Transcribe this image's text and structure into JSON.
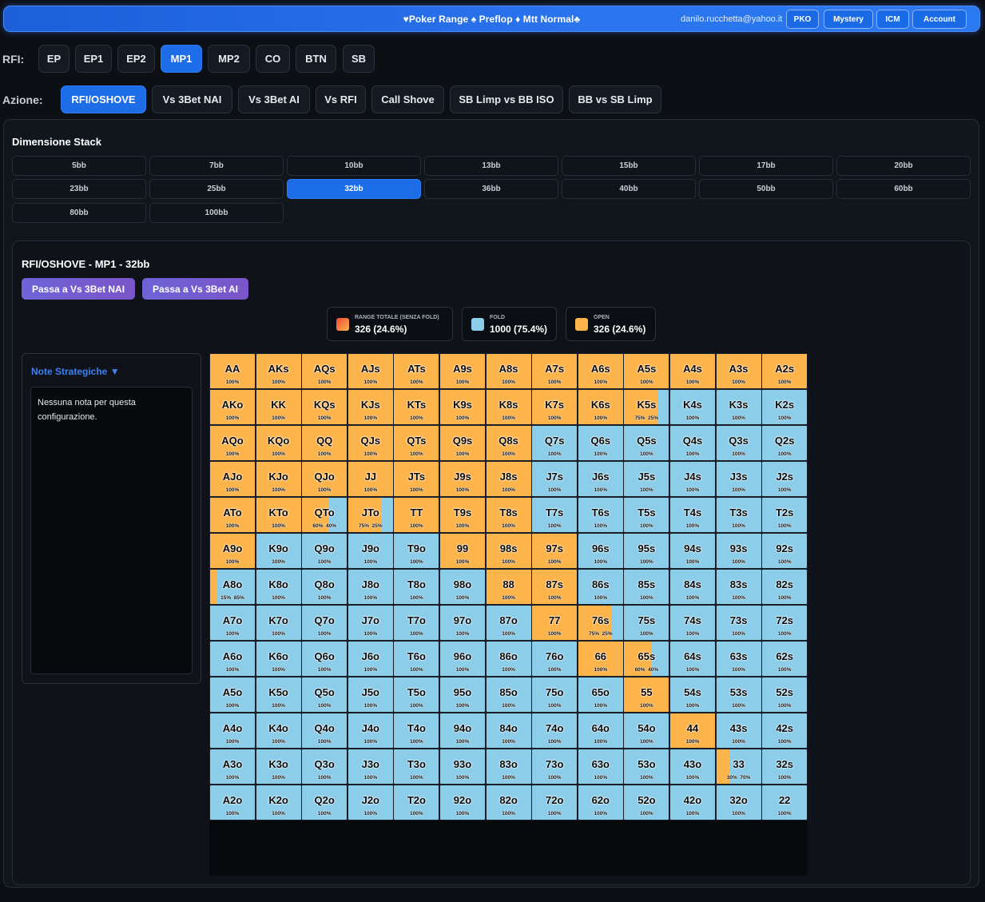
{
  "header": {
    "title": "♥Poker Range ♠ Preflop ♦ Mtt Normal♣",
    "email": "danilo.rucchetta@yahoo.it",
    "buttons": [
      "PKO",
      "Mystery",
      "ICM",
      "Account"
    ]
  },
  "rfi": {
    "label": "RFI:",
    "positions": [
      "EP",
      "EP1",
      "EP2",
      "MP1",
      "MP2",
      "CO",
      "BTN",
      "SB"
    ],
    "active": "MP1"
  },
  "azione": {
    "label": "Azione:",
    "actions": [
      "RFI/OSHOVE",
      "Vs 3Bet NAI",
      "Vs 3Bet AI",
      "Vs RFI",
      "Call Shove",
      "SB Limp vs BB ISO",
      "BB vs SB Limp"
    ],
    "active": "RFI/OSHOVE"
  },
  "stack": {
    "title": "Dimensione Stack",
    "sizes": [
      "5bb",
      "7bb",
      "10bb",
      "13bb",
      "15bb",
      "17bb",
      "20bb",
      "23bb",
      "25bb",
      "32bb",
      "36bb",
      "40bb",
      "50bb",
      "60bb",
      "80bb",
      "100bb"
    ],
    "active": "32bb"
  },
  "range": {
    "title": "RFI/OSHOVE - MP1 - 32bb",
    "buttons": [
      "Passa a Vs 3Bet NAI",
      "Passa a Vs 3Bet AI"
    ]
  },
  "stats": [
    {
      "label": "RANGE TOTALE (SENZA FOLD)",
      "value": "326 (24.6%)",
      "swatch": "gradient"
    },
    {
      "label": "FOLD",
      "value": "1000 (75.4%)",
      "swatch": "#8ccde9"
    },
    {
      "label": "OPEN",
      "value": "326 (24.6%)",
      "swatch": "#fdb44b"
    }
  ],
  "notes": {
    "title": "Note Strategiche ▼",
    "text": "Nessuna nota per questa configurazione."
  },
  "colors": {
    "open": "#fdb44b",
    "fold": "#8ccde9",
    "accent": "#1d6ce8"
  },
  "grid": {
    "hands": [
      [
        "AA",
        "AKs",
        "AQs",
        "AJs",
        "ATs",
        "A9s",
        "A8s",
        "A7s",
        "A6s",
        "A5s",
        "A4s",
        "A3s",
        "A2s"
      ],
      [
        "AKo",
        "KK",
        "KQs",
        "KJs",
        "KTs",
        "K9s",
        "K8s",
        "K7s",
        "K6s",
        "K5s",
        "K4s",
        "K3s",
        "K2s"
      ],
      [
        "AQo",
        "KQo",
        "QQ",
        "QJs",
        "QTs",
        "Q9s",
        "Q8s",
        "Q7s",
        "Q6s",
        "Q5s",
        "Q4s",
        "Q3s",
        "Q2s"
      ],
      [
        "AJo",
        "KJo",
        "QJo",
        "JJ",
        "JTs",
        "J9s",
        "J8s",
        "J7s",
        "J6s",
        "J5s",
        "J4s",
        "J3s",
        "J2s"
      ],
      [
        "ATo",
        "KTo",
        "QTo",
        "JTo",
        "TT",
        "T9s",
        "T8s",
        "T7s",
        "T6s",
        "T5s",
        "T4s",
        "T3s",
        "T2s"
      ],
      [
        "A9o",
        "K9o",
        "Q9o",
        "J9o",
        "T9o",
        "99",
        "98s",
        "97s",
        "96s",
        "95s",
        "94s",
        "93s",
        "92s"
      ],
      [
        "A8o",
        "K8o",
        "Q8o",
        "J8o",
        "T8o",
        "98o",
        "88",
        "87s",
        "86s",
        "85s",
        "84s",
        "83s",
        "82s"
      ],
      [
        "A7o",
        "K7o",
        "Q7o",
        "J7o",
        "T7o",
        "97o",
        "87o",
        "77",
        "76s",
        "75s",
        "74s",
        "73s",
        "72s"
      ],
      [
        "A6o",
        "K6o",
        "Q6o",
        "J6o",
        "T6o",
        "96o",
        "86o",
        "76o",
        "66",
        "65s",
        "64s",
        "63s",
        "62s"
      ],
      [
        "A5o",
        "K5o",
        "Q5o",
        "J5o",
        "T5o",
        "95o",
        "85o",
        "75o",
        "65o",
        "55",
        "54s",
        "53s",
        "52s"
      ],
      [
        "A4o",
        "K4o",
        "Q4o",
        "J4o",
        "T4o",
        "94o",
        "84o",
        "74o",
        "64o",
        "54o",
        "44",
        "43s",
        "42s"
      ],
      [
        "A3o",
        "K3o",
        "Q3o",
        "J3o",
        "T3o",
        "93o",
        "83o",
        "73o",
        "63o",
        "53o",
        "43o",
        "33",
        "32s"
      ],
      [
        "A2o",
        "K2o",
        "Q2o",
        "J2o",
        "T2o",
        "92o",
        "82o",
        "72o",
        "62o",
        "52o",
        "42o",
        "32o",
        "22"
      ]
    ],
    "open_fraction": [
      [
        1,
        1,
        1,
        1,
        1,
        1,
        1,
        1,
        1,
        1,
        1,
        1,
        1
      ],
      [
        1,
        1,
        1,
        1,
        1,
        1,
        1,
        1,
        1,
        0.75,
        0,
        0,
        0
      ],
      [
        1,
        1,
        1,
        1,
        1,
        1,
        1,
        0,
        0,
        0,
        0,
        0,
        0
      ],
      [
        1,
        1,
        1,
        1,
        1,
        1,
        1,
        0,
        0,
        0,
        0,
        0,
        0
      ],
      [
        1,
        1,
        0.6,
        0.75,
        1,
        1,
        1,
        0,
        0,
        0,
        0,
        0,
        0
      ],
      [
        1,
        0,
        0,
        0,
        0,
        1,
        1,
        1,
        0,
        0,
        0,
        0,
        0
      ],
      [
        0.15,
        0,
        0,
        0,
        0,
        0,
        1,
        1,
        0,
        0,
        0,
        0,
        0
      ],
      [
        0,
        0,
        0,
        0,
        0,
        0,
        0,
        1,
        0.75,
        0,
        0,
        0,
        0
      ],
      [
        0,
        0,
        0,
        0,
        0,
        0,
        0,
        0,
        1,
        0.6,
        0,
        0,
        0
      ],
      [
        0,
        0,
        0,
        0,
        0,
        0,
        0,
        0,
        0,
        1,
        0,
        0,
        0
      ],
      [
        0,
        0,
        0,
        0,
        0,
        0,
        0,
        0,
        0,
        0,
        1,
        0,
        0
      ],
      [
        0,
        0,
        0,
        0,
        0,
        0,
        0,
        0,
        0,
        0,
        0,
        0.3,
        0
      ],
      [
        0,
        0,
        0,
        0,
        0,
        0,
        0,
        0,
        0,
        0,
        0,
        0,
        0
      ]
    ],
    "labels": [
      [
        "100%",
        "100%",
        "100%",
        "100%",
        "100%",
        "100%",
        "100%",
        "100%",
        "100%",
        "100%",
        "100%",
        "100%",
        "100%"
      ],
      [
        "100%",
        "100%",
        "100%",
        "100%",
        "100%",
        "100%",
        "100%",
        "100%",
        "100%",
        "75%  25%",
        "100%",
        "100%",
        "100%"
      ],
      [
        "100%",
        "100%",
        "100%",
        "100%",
        "100%",
        "100%",
        "100%",
        "100%",
        "100%",
        "100%",
        "100%",
        "100%",
        "100%"
      ],
      [
        "100%",
        "100%",
        "100%",
        "100%",
        "100%",
        "100%",
        "100%",
        "100%",
        "100%",
        "100%",
        "100%",
        "100%",
        "100%"
      ],
      [
        "100%",
        "100%",
        "60%  40%",
        "75%  25%",
        "100%",
        "100%",
        "100%",
        "100%",
        "100%",
        "100%",
        "100%",
        "100%",
        "100%"
      ],
      [
        "100%",
        "100%",
        "100%",
        "100%",
        "100%",
        "100%",
        "100%",
        "100%",
        "100%",
        "100%",
        "100%",
        "100%",
        "100%"
      ],
      [
        "15%  85%",
        "100%",
        "100%",
        "100%",
        "100%",
        "100%",
        "100%",
        "100%",
        "100%",
        "100%",
        "100%",
        "100%",
        "100%"
      ],
      [
        "100%",
        "100%",
        "100%",
        "100%",
        "100%",
        "100%",
        "100%",
        "100%",
        "75%  25%",
        "100%",
        "100%",
        "100%",
        "100%"
      ],
      [
        "100%",
        "100%",
        "100%",
        "100%",
        "100%",
        "100%",
        "100%",
        "100%",
        "100%",
        "60%  40%",
        "100%",
        "100%",
        "100%"
      ],
      [
        "100%",
        "100%",
        "100%",
        "100%",
        "100%",
        "100%",
        "100%",
        "100%",
        "100%",
        "100%",
        "100%",
        "100%",
        "100%"
      ],
      [
        "100%",
        "100%",
        "100%",
        "100%",
        "100%",
        "100%",
        "100%",
        "100%",
        "100%",
        "100%",
        "100%",
        "100%",
        "100%"
      ],
      [
        "100%",
        "100%",
        "100%",
        "100%",
        "100%",
        "100%",
        "100%",
        "100%",
        "100%",
        "100%",
        "100%",
        "30%  70%",
        "100%"
      ],
      [
        "100%",
        "100%",
        "100%",
        "100%",
        "100%",
        "100%",
        "100%",
        "100%",
        "100%",
        "100%",
        "100%",
        "100%",
        "100%"
      ]
    ]
  }
}
